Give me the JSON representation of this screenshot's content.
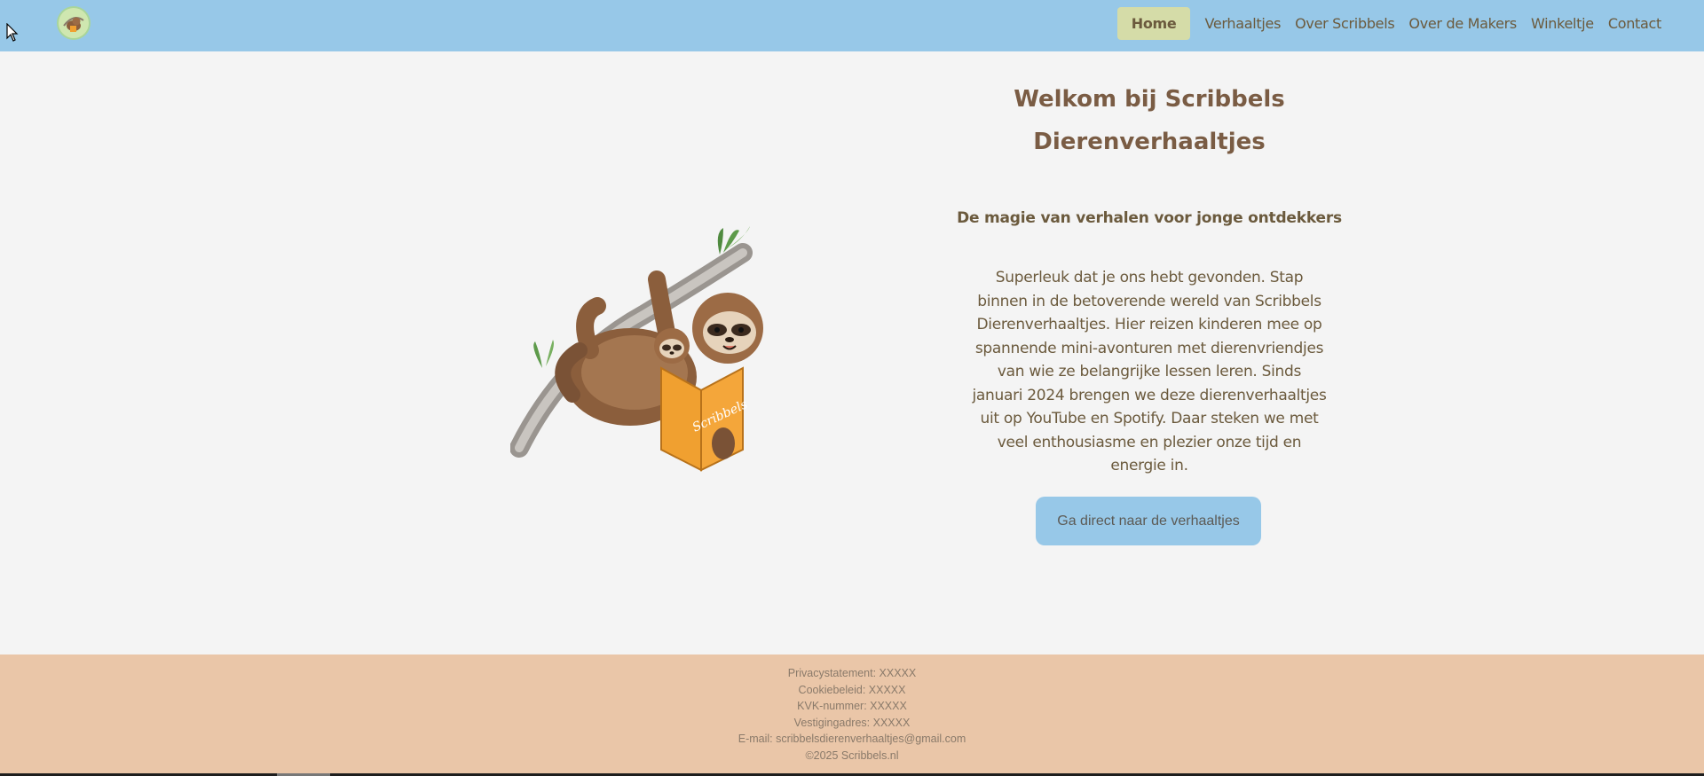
{
  "colors": {
    "nav_bg": "#97c8e8",
    "nav_active_bg": "#d5dca8",
    "cta_bg": "#97c8e8",
    "footer_bg": "#eac6a8",
    "text_brown": "#6b5a3d"
  },
  "header": {
    "logo_icon": "sloth-logo-icon",
    "nav": [
      {
        "label": "Home",
        "active": true
      },
      {
        "label": "Verhaaltjes",
        "active": false
      },
      {
        "label": "Over Scribbels",
        "active": false
      },
      {
        "label": "Over de Makers",
        "active": false
      },
      {
        "label": "Winkeltje",
        "active": false
      },
      {
        "label": "Contact",
        "active": false
      }
    ]
  },
  "hero": {
    "illustration_icon": "sloth-reading-book-icon",
    "book_text": "Scribbels",
    "title_line1": "Welkom bij Scribbels",
    "title_line2": "Dierenverhaaltjes",
    "subtitle": "De magie van verhalen voor jonge ontdekkers",
    "intro": "Superleuk dat je ons hebt gevonden. Stap binnen in de betoverende wereld van Scribbels Dierenverhaaltjes. Hier reizen kinderen mee op spannende mini-avonturen met dierenvriendjes van wie ze belangrijke lessen leren. Sinds januari 2024 brengen we deze dierenverhaaltjes uit op YouTube en Spotify. Daar steken we met veel enthousiasme en plezier onze tijd en energie in.",
    "cta_label": "Ga direct naar de verhaaltjes"
  },
  "footer": {
    "lines": [
      "Privacystatement: XXXXX",
      "Cookiebeleid: XXXXX",
      "KVK-nummer: XXXXX",
      "Vestigingadres: XXXXX",
      "E-mail: scribbelsdierenverhaaltjes@gmail.com",
      "©2025 Scribbels.nl"
    ]
  }
}
